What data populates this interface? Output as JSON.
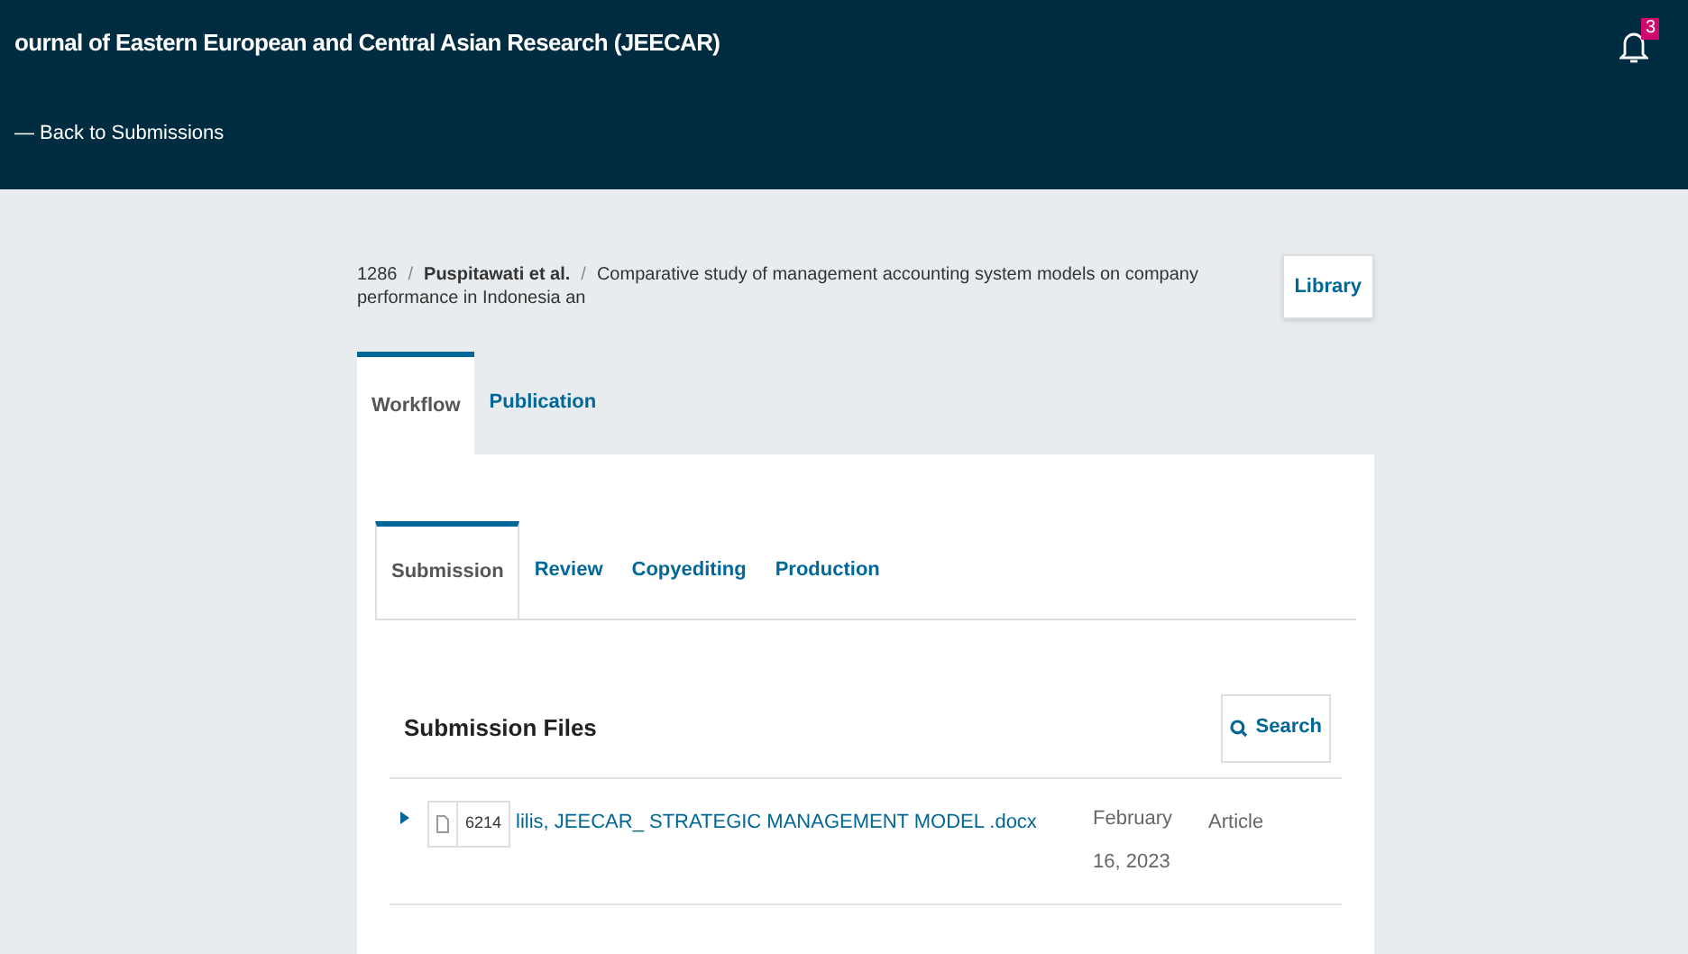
{
  "header": {
    "title": "ournal of Eastern European and Central Asian Research (JEECAR)",
    "back_link": "— Back to Submissions",
    "notifications": {
      "count": "3"
    }
  },
  "breadcrumb": {
    "id": "1286",
    "separator": "/",
    "authors": "Puspitawati et al.",
    "title": "Comparative study of management accounting system models on company performance in Indonesia an",
    "library_button": "Library"
  },
  "tabs": [
    {
      "label": "Workflow",
      "selected": true
    },
    {
      "label": "Publication",
      "selected": false
    }
  ],
  "stage_tabs": [
    {
      "label": "Submission",
      "selected": true
    },
    {
      "label": "Review",
      "selected": false
    },
    {
      "label": "Copyediting",
      "selected": false
    },
    {
      "label": "Production",
      "selected": false
    }
  ],
  "files": {
    "heading": "Submission Files",
    "search_button": "Search",
    "rows": [
      {
        "expanded": false,
        "id": "6214",
        "name": "lilis, JEECAR_ STRATEGIC MANAGEMENT MODEL .docx",
        "date": "February 16, 2023",
        "type": "Article"
      }
    ]
  }
}
